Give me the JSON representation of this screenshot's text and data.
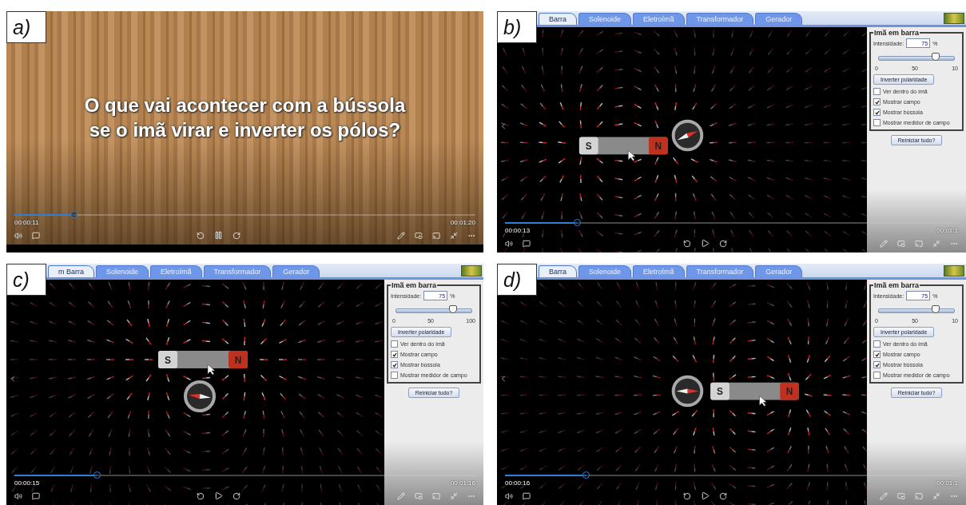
{
  "panels": [
    {
      "kind": "title",
      "label": "a)",
      "caption": "O que vai acontecer com a bússola se o imã virar e inverter os pólos?",
      "player": {
        "current": "00:00:11",
        "total": "00:01:20",
        "level": 0.13,
        "playing": true
      }
    },
    {
      "kind": "sim",
      "label": "b)",
      "tabs": [
        {
          "label": "Barra",
          "selected": true
        },
        {
          "label": "Solenoide",
          "selected": false
        },
        {
          "label": "Eletroímã",
          "selected": false
        },
        {
          "label": "Transformador",
          "selected": false
        },
        {
          "label": "Gerador",
          "selected": false
        }
      ],
      "scene": {
        "kind": "right"
      },
      "magnet": {
        "left_pole": "S",
        "right_pole": "N"
      },
      "controls": {
        "title": "Imã em barra",
        "intensity_label": "Intensidade:",
        "intensity_value": "75",
        "unit": "%",
        "slider": {
          "level": 0.75,
          "ticks": [
            "0",
            "50",
            "10"
          ]
        },
        "button": "Inverter polaridade",
        "options": [
          {
            "label": "Ver dentro do ímã",
            "checked": false
          },
          {
            "label": "Mostrar campo",
            "checked": true
          },
          {
            "label": "Mostrar bússola",
            "checked": true
          },
          {
            "label": "Mostrar medidor de campo",
            "checked": false
          }
        ],
        "reset": "Reiniciar tudo?"
      },
      "player": {
        "current": "00:00:13",
        "total": "00:01:1",
        "level": 0.16,
        "playing": false
      }
    },
    {
      "kind": "sim",
      "label": "c)",
      "tabs": [
        {
          "label": "m Barra",
          "selected": true
        },
        {
          "label": "Solenoide",
          "selected": false
        },
        {
          "label": "Eletroímã",
          "selected": false
        },
        {
          "label": "Transformador",
          "selected": false
        },
        {
          "label": "Gerador",
          "selected": false
        }
      ],
      "scene": {
        "kind": "below"
      },
      "magnet": {
        "left_pole": "S",
        "right_pole": "N"
      },
      "controls": {
        "title": "Imã em barra",
        "intensity_label": "Intensidade:",
        "intensity_value": "75",
        "unit": "%",
        "slider": {
          "level": 0.75,
          "ticks": [
            "0",
            "50",
            "100"
          ]
        },
        "button": "Inverter polaridade",
        "options": [
          {
            "label": "Ver dentro do ímã",
            "checked": false
          },
          {
            "label": "Mostrar campo",
            "checked": true
          },
          {
            "label": "Mostrar bússola",
            "checked": true
          },
          {
            "label": "Mostrar medidor de campo",
            "checked": false
          }
        ],
        "reset": "Reiniciar tudo?"
      },
      "player": {
        "current": "00:00:15",
        "total": "00:01:16",
        "level": 0.18,
        "playing": false
      }
    },
    {
      "kind": "sim",
      "label": "d)",
      "tabs": [
        {
          "label": "Barra",
          "selected": true
        },
        {
          "label": "Solenoide",
          "selected": false
        },
        {
          "label": "Eletroímã",
          "selected": false
        },
        {
          "label": "Transformador",
          "selected": false
        },
        {
          "label": "Gerador",
          "selected": false
        }
      ],
      "scene": {
        "kind": "left"
      },
      "magnet": {
        "left_pole": "S",
        "right_pole": "N"
      },
      "controls": {
        "title": "Imã em barra",
        "intensity_label": "Intensidade:",
        "intensity_value": "75",
        "unit": "%",
        "slider": {
          "level": 0.75,
          "ticks": [
            "0",
            "50",
            "10"
          ]
        },
        "button": "Inverter polaridade",
        "options": [
          {
            "label": "Ver dentro do ímã",
            "checked": false
          },
          {
            "label": "Mostrar campo",
            "checked": true
          },
          {
            "label": "Mostrar bússola",
            "checked": true
          },
          {
            "label": "Mostrar medidor de campo",
            "checked": false
          }
        ],
        "reset": "Reiniciar tudo?"
      },
      "player": {
        "current": "00:00:16",
        "total": "00:01:1",
        "level": 0.18,
        "playing": false
      }
    }
  ]
}
